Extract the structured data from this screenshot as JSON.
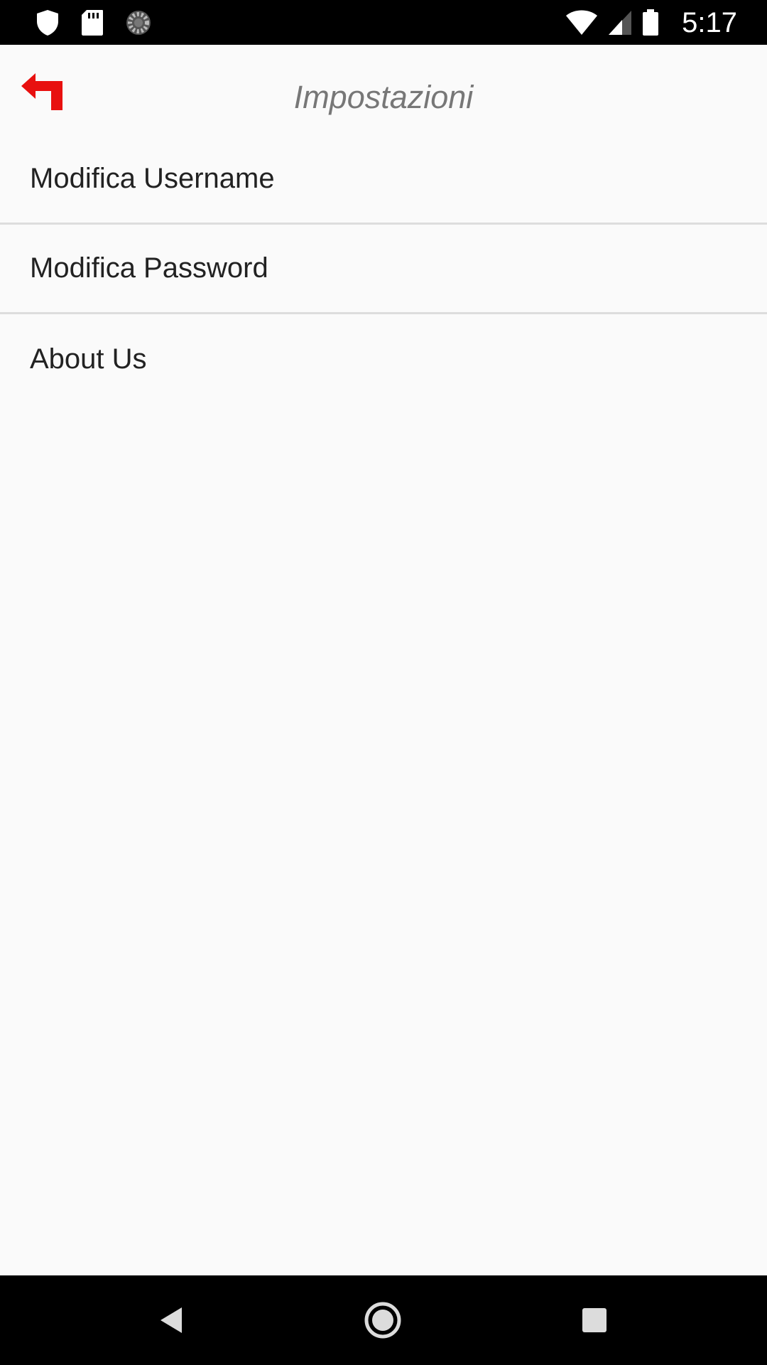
{
  "status_bar": {
    "time": "5:17",
    "left_icons": [
      "shield-icon",
      "sd-card-icon",
      "sync-spinner-icon"
    ],
    "right_icons": [
      "wifi-icon",
      "signal-icon",
      "battery-icon"
    ]
  },
  "header": {
    "title": "Impostazioni",
    "back_icon": "back-arrow-icon",
    "accent_color": "#e8100f"
  },
  "settings": {
    "items": [
      {
        "label": "Modifica Username"
      },
      {
        "label": "Modifica Password"
      },
      {
        "label": "About Us"
      }
    ]
  },
  "nav_bar": {
    "buttons": [
      "back-triangle-icon",
      "home-circle-icon",
      "recents-square-icon"
    ]
  }
}
